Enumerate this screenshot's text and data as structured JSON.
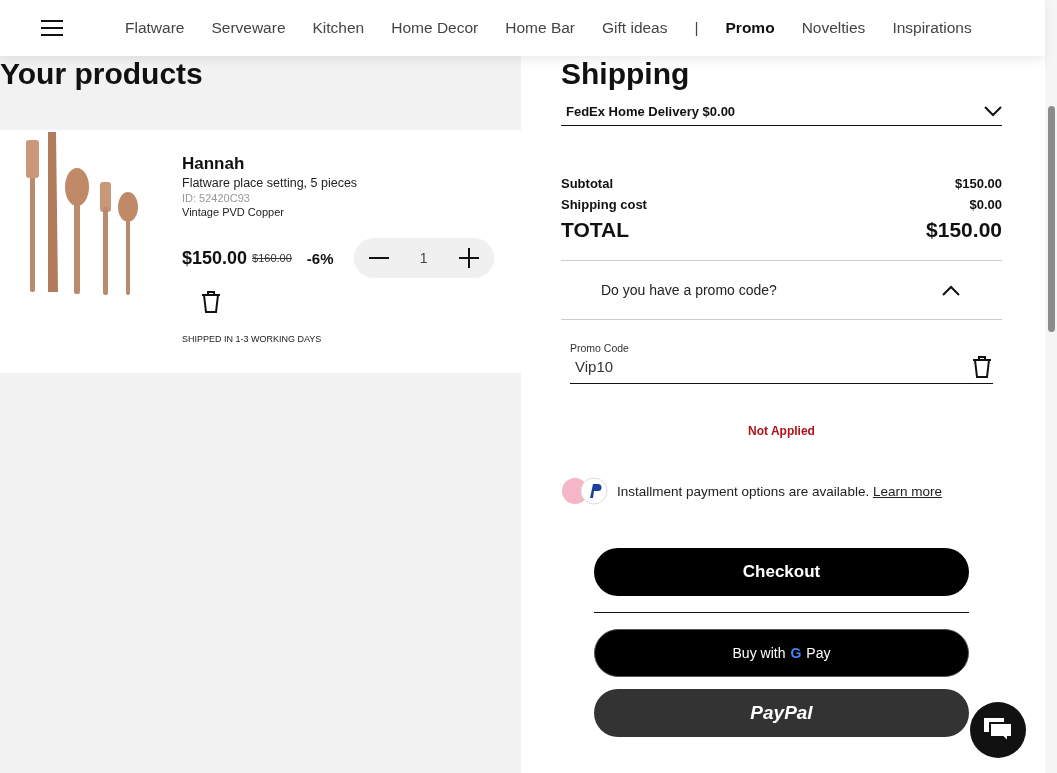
{
  "nav": {
    "left_items": [
      {
        "label": "Flatware",
        "selected": false
      },
      {
        "label": "Serveware",
        "selected": false
      },
      {
        "label": "Kitchen",
        "selected": false
      },
      {
        "label": "Home Decor",
        "selected": false
      },
      {
        "label": "Home Bar",
        "selected": false
      },
      {
        "label": "Gift ideas",
        "selected": false
      }
    ],
    "separator": "|",
    "right_items": [
      {
        "label": "Promo",
        "selected": true
      },
      {
        "label": "Novelties",
        "selected": false
      },
      {
        "label": "Inspirations",
        "selected": false
      }
    ]
  },
  "products": {
    "heading": "Your products",
    "items": [
      {
        "name": "Hannah",
        "description": "Flatware place setting, 5 pieces",
        "id": "ID: 52420C93",
        "finish": "Vintage PVD Copper",
        "price": "$150.00",
        "old_price": "$160.00",
        "discount": "-6%",
        "quantity": "1",
        "shipping_note": "SHIPPED IN 1-3 WORKING DAYS"
      }
    ]
  },
  "shipping": {
    "heading": "Shipping",
    "method": "FedEx Home Delivery $0.00",
    "totals": [
      {
        "label": "Subtotal",
        "value": "$150.00",
        "kind": "line"
      },
      {
        "label": "Shipping cost",
        "value": "$0.00",
        "kind": "line"
      },
      {
        "label": "TOTAL",
        "value": "$150.00",
        "kind": "total"
      }
    ],
    "promo": {
      "question": "Do you have a promo code?",
      "expanded": true,
      "field_label": "Promo Code",
      "value": "Vip10",
      "status": "Not Applied"
    },
    "installments": {
      "text": "Installment payment options are available.",
      "link": "Learn more"
    },
    "buttons": [
      {
        "kind": "checkout",
        "label": "Checkout"
      },
      {
        "kind": "gpay",
        "prefix": "Buy with",
        "mark": "G",
        "suffix": "Pay"
      },
      {
        "kind": "paypal",
        "label": "PayPal"
      }
    ]
  }
}
